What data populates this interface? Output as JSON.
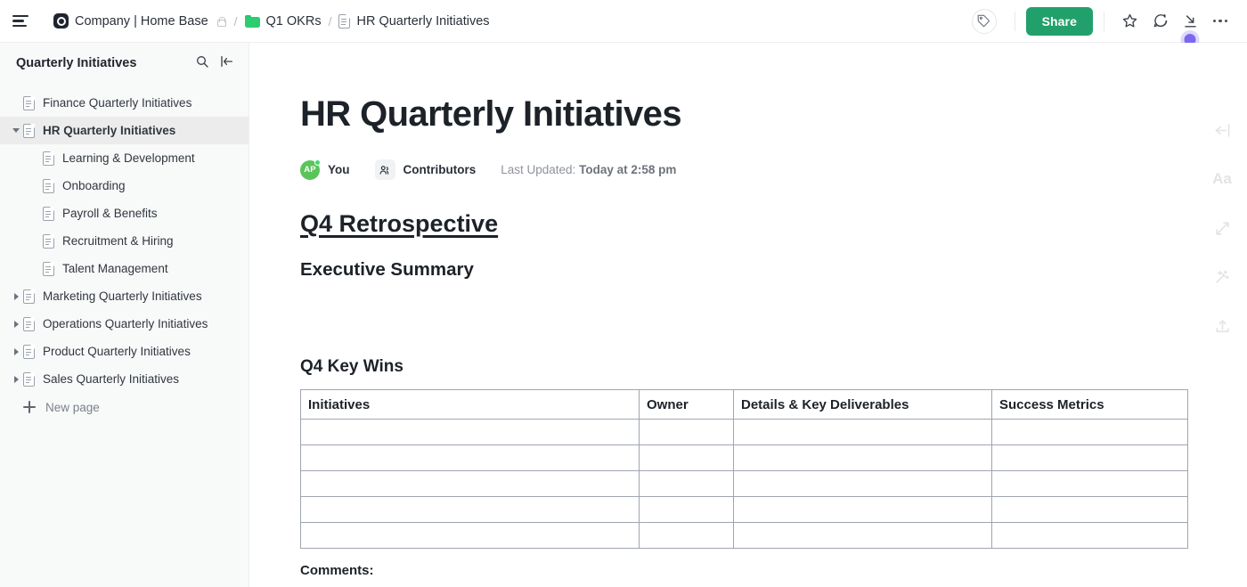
{
  "topbar": {
    "menu_icon": "hamburger-icon",
    "breadcrumb": [
      {
        "icon": "company-badge-icon",
        "label": "Company | Home Base",
        "trailing_icon": "lock-icon"
      },
      {
        "icon": "folder-icon",
        "label": "Q1 OKRs"
      },
      {
        "icon": "doc-icon",
        "label": "HR Quarterly Initiatives"
      }
    ],
    "separator": "/",
    "tag_icon": "tag-icon",
    "share_label": "Share",
    "star_icon": "star-icon",
    "comment_icon": "comment-icon",
    "collapse_icon": "collapse-down-right-icon",
    "more_icon": "more-options-icon",
    "accent_color": "#22a06b",
    "cursor_color": "#7b68ee"
  },
  "sidebar": {
    "title": "Quarterly Initiatives",
    "search_icon": "search-icon",
    "collapse_icon": "collapse-sidebar-icon",
    "items": [
      {
        "label": "Finance Quarterly Initiatives",
        "level": 0,
        "twisty": "none",
        "selected": false
      },
      {
        "label": "HR Quarterly Initiatives",
        "level": 0,
        "twisty": "down",
        "selected": true
      },
      {
        "label": "Learning & Development",
        "level": 1,
        "twisty": "none",
        "selected": false
      },
      {
        "label": "Onboarding",
        "level": 1,
        "twisty": "none",
        "selected": false
      },
      {
        "label": "Payroll & Benefits",
        "level": 1,
        "twisty": "none",
        "selected": false
      },
      {
        "label": "Recruitment & Hiring",
        "level": 1,
        "twisty": "none",
        "selected": false
      },
      {
        "label": "Talent Management",
        "level": 1,
        "twisty": "none",
        "selected": false
      },
      {
        "label": "Marketing Quarterly Initiatives",
        "level": 0,
        "twisty": "right",
        "selected": false
      },
      {
        "label": "Operations Quarterly Initiatives",
        "level": 0,
        "twisty": "right",
        "selected": false
      },
      {
        "label": "Product Quarterly Initiatives",
        "level": 0,
        "twisty": "right",
        "selected": false
      },
      {
        "label": "Sales Quarterly Initiatives",
        "level": 0,
        "twisty": "right",
        "selected": false
      }
    ],
    "new_page_label": "New page"
  },
  "document": {
    "title": "HR Quarterly Initiatives",
    "avatar_initials": "AP",
    "you_label": "You",
    "contributors_label": "Contributors",
    "contributors_icon": "contributors-icon",
    "last_updated_prefix": "Last Updated:",
    "last_updated_value": "Today at 2:58 pm",
    "heading_retrospective": "Q4 Retrospective",
    "heading_executive_summary": "Executive Summary",
    "heading_key_wins": "Q4 Key Wins",
    "table": {
      "headers": [
        "Initiatives",
        "Owner",
        "Details & Key Deliverables",
        "Success Metrics"
      ],
      "rows": [
        [
          "",
          "",
          "",
          ""
        ],
        [
          "",
          "",
          "",
          ""
        ],
        [
          "",
          "",
          "",
          ""
        ],
        [
          "",
          "",
          "",
          ""
        ],
        [
          "",
          "",
          "",
          ""
        ]
      ]
    },
    "comments_label": "Comments:"
  },
  "rail": {
    "icons": [
      "expand-left-icon",
      "font-size-icon",
      "resize-diagonal-icon",
      "magic-wand-icon",
      "upload-icon"
    ],
    "font_label": "Aa"
  }
}
